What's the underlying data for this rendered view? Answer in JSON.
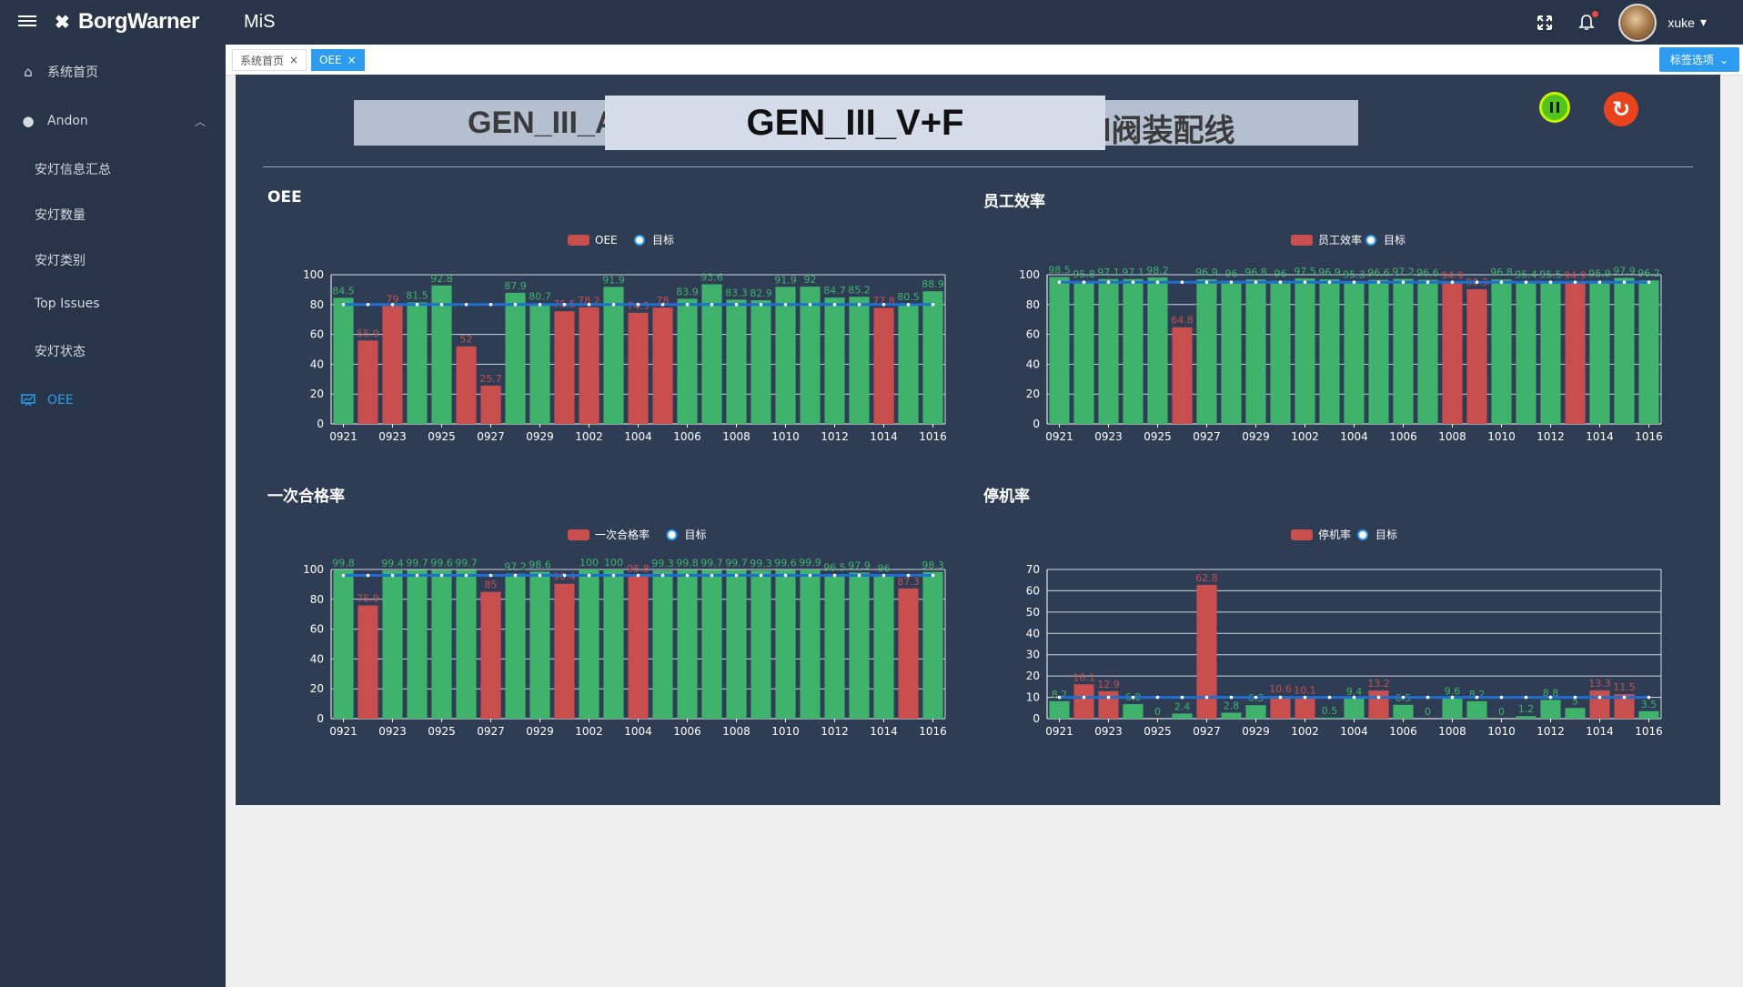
{
  "header": {
    "brand": "BorgWarner",
    "app_title": "MiS",
    "user": "xuke",
    "icons": [
      "menu-icon",
      "fullscreen-icon",
      "bell-icon",
      "avatar"
    ]
  },
  "sidebar": {
    "items": [
      {
        "label": "系统首页",
        "icon": "home-icon"
      },
      {
        "label": "Andon",
        "icon": "bulb-icon"
      },
      {
        "label": "安灯信息汇总"
      },
      {
        "label": "安灯数量"
      },
      {
        "label": "安灯类别"
      },
      {
        "label": "Top Issues"
      },
      {
        "label": "安灯状态"
      },
      {
        "label": "OEE",
        "icon": "chart-icon"
      }
    ]
  },
  "tabs": {
    "items": [
      {
        "label": "系统首页"
      },
      {
        "label": "OEE"
      }
    ],
    "options_label": "标签选项"
  },
  "banner": {
    "left_text": "GEN_III_A",
    "center_text": "GEN_III_V+F",
    "right_text": "l阀装配线"
  },
  "colors": {
    "above": "#3fb36c",
    "below": "#c94f4f",
    "target": "#1f6fd1",
    "panel": "#2e3c54"
  },
  "chart_data": [
    {
      "type": "bar",
      "title": "OEE",
      "legend": [
        "OEE",
        "目标"
      ],
      "xticks": [
        "0921",
        "0923",
        "0925",
        "0927",
        "0929",
        "1002",
        "1004",
        "1006",
        "1008",
        "1010",
        "1012",
        "1014",
        "1016"
      ],
      "values": [
        84.5,
        55.9,
        79,
        81.5,
        92.8,
        52,
        25.7,
        87.9,
        80.7,
        75.5,
        78.2,
        91.9,
        74.5,
        78,
        83.9,
        93.6,
        83.3,
        82.9,
        91.9,
        92,
        84.7,
        85.2,
        77.8,
        80.5,
        88.9
      ],
      "target": 80,
      "ylim": [
        0,
        100
      ],
      "yticks": [
        0,
        20,
        40,
        60,
        80,
        100
      ]
    },
    {
      "type": "bar",
      "title": "员工效率",
      "legend": [
        "员工效率",
        "目标"
      ],
      "xticks": [
        "0921",
        "0923",
        "0925",
        "0927",
        "0929",
        "1002",
        "1004",
        "1006",
        "1008",
        "1010",
        "1012",
        "1014",
        "1016"
      ],
      "values": [
        98.5,
        95.8,
        97.1,
        97.1,
        98.2,
        64.8,
        96.9,
        96,
        96.8,
        96,
        97.5,
        96.9,
        95.3,
        96.6,
        97.2,
        96.6,
        94.9,
        90.3,
        96.8,
        95.4,
        95.5,
        94.9,
        95.9,
        97.9,
        96.2
      ],
      "target": 95,
      "ylim": [
        0,
        100
      ],
      "yticks": [
        0,
        20,
        40,
        60,
        80,
        100
      ]
    },
    {
      "type": "bar",
      "title": "一次合格率",
      "legend": [
        "一次合格率",
        "目标"
      ],
      "xticks": [
        "0921",
        "0923",
        "0925",
        "0927",
        "0929",
        "1002",
        "1004",
        "1006",
        "1008",
        "1010",
        "1012",
        "1014",
        "1016"
      ],
      "values": [
        99.8,
        75.9,
        99.4,
        99.7,
        99.6,
        99.7,
        85,
        97.2,
        98.6,
        90.4,
        100,
        100,
        95.8,
        99.3,
        99.8,
        99.7,
        99.7,
        99.3,
        99.6,
        99.9,
        96.5,
        97.9,
        96,
        87.3,
        98.3
      ],
      "target": 96,
      "ylim": [
        0,
        100
      ],
      "yticks": [
        0,
        20,
        40,
        60,
        80,
        100
      ]
    },
    {
      "type": "bar",
      "title": "停机率",
      "legend": [
        "停机率",
        "目标"
      ],
      "xticks": [
        "0921",
        "0923",
        "0925",
        "0927",
        "0929",
        "1002",
        "1004",
        "1006",
        "1008",
        "1010",
        "1012",
        "1014",
        "1016"
      ],
      "values": [
        8.2,
        16.1,
        12.9,
        6.8,
        0,
        2.4,
        62.8,
        2.8,
        6.3,
        10.6,
        10.1,
        0.5,
        9.4,
        13.2,
        6.5,
        0,
        9.6,
        8.2,
        0,
        1.2,
        8.8,
        5,
        13.3,
        11.5,
        3.5
      ],
      "target": 10,
      "lower_is_better": true,
      "ylim": [
        0,
        70
      ],
      "yticks": [
        0,
        10,
        20,
        30,
        40,
        50,
        60,
        70
      ]
    }
  ]
}
